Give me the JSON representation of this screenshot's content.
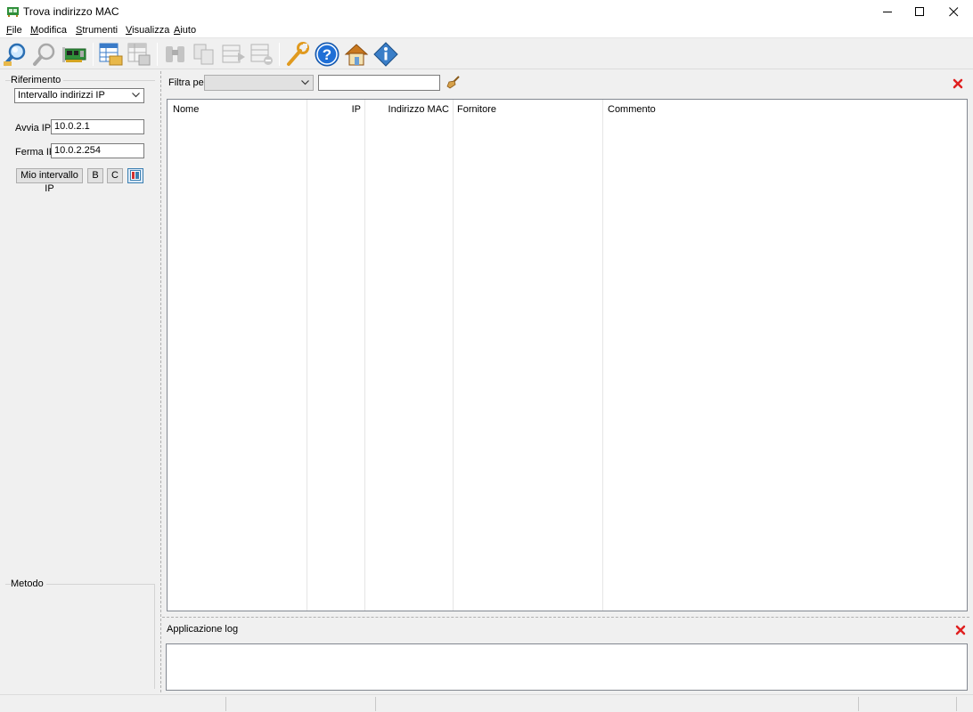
{
  "window": {
    "title": "Trova indirizzo MAC",
    "controls": [
      "minimize-icon",
      "maximize-icon",
      "close-icon"
    ]
  },
  "menu": {
    "items": [
      "File",
      "Modifica",
      "Strumenti",
      "Visualizza",
      "Aiuto"
    ]
  },
  "toolbar": {
    "buttons": [
      {
        "name": "scan-icon",
        "enabled": true
      },
      {
        "name": "stop-scan-icon",
        "enabled": false
      },
      {
        "name": "network-card-icon",
        "enabled": true
      },
      {
        "name": "open-table-icon",
        "enabled": true
      },
      {
        "name": "save-table-icon",
        "enabled": false
      },
      {
        "name": "find-icon",
        "enabled": false
      },
      {
        "name": "copy-icon",
        "enabled": false
      },
      {
        "name": "export-icon",
        "enabled": false
      },
      {
        "name": "delete-icon",
        "enabled": false
      },
      {
        "name": "settings-wrench-icon",
        "enabled": true
      },
      {
        "name": "help-icon",
        "enabled": true
      },
      {
        "name": "home-icon",
        "enabled": true
      },
      {
        "name": "info-icon",
        "enabled": true
      }
    ]
  },
  "left_panel": {
    "reference": {
      "label": "Riferimento",
      "range_type": "Intervallo indirizzi IP",
      "start_label": "Avvia IP:",
      "start_value": "10.0.2.1",
      "stop_label": "Ferma IP:",
      "stop_value": "10.0.2.254",
      "buttons": {
        "my_range": "Mio intervallo IP",
        "class_b": "B",
        "class_c": "C"
      }
    },
    "method": {
      "label": "Metodo"
    }
  },
  "filter": {
    "label": "Filtra per",
    "selected": "",
    "text": ""
  },
  "grid": {
    "columns": [
      "Nome",
      "IP",
      "Indirizzo MAC",
      "Fornitore",
      "Commento"
    ],
    "rows": []
  },
  "log": {
    "label": "Applicazione log",
    "content": ""
  },
  "colors": {
    "accent_red": "#e02020",
    "help_blue": "#1f6fd6",
    "folder_yellow": "#e8b84a"
  }
}
